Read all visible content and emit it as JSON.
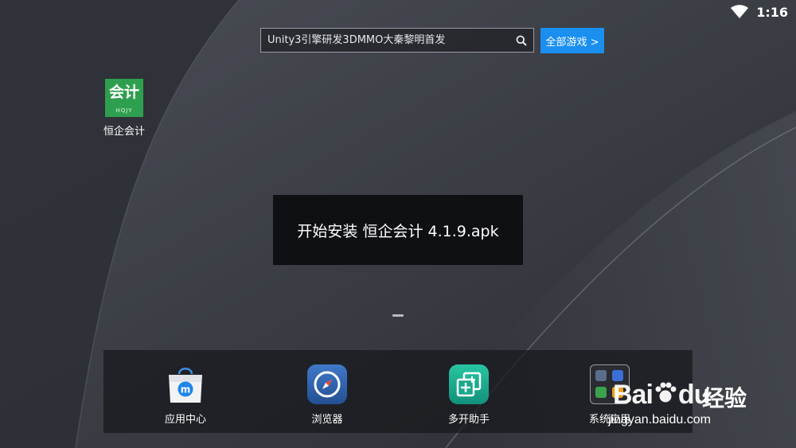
{
  "status_bar": {
    "time": "1:16",
    "wifi_icon": "wifi-icon"
  },
  "search": {
    "placeholder": "Unity3引擎研发3DMMO大秦黎明首发",
    "icon": "search-icon"
  },
  "all_games_label": "全部游戏 >",
  "desktop_apps": [
    {
      "label": "恒企会计",
      "icon_text": "会计",
      "icon_subtext": "HQJY",
      "icon_color": "#2e9f4e"
    }
  ],
  "toast": {
    "message": "开始安装 恒企会计 4.1.9.apk"
  },
  "dock": {
    "items": [
      {
        "label": "应用中心",
        "icon": "shopping-bag-icon"
      },
      {
        "label": "浏览器",
        "icon": "compass-icon"
      },
      {
        "label": "多开助手",
        "icon": "multi-window-icon"
      },
      {
        "label": "系统应用",
        "icon": "app-folder-icon"
      }
    ]
  },
  "watermark": {
    "logo": "Bai",
    "logo_suffix": "du",
    "cn": "经验",
    "url": "jingyan.baidu.com"
  },
  "colors": {
    "accent": "#1a8ff0",
    "dock_bg": "#16181c",
    "toast_bg": "#0f1013"
  }
}
